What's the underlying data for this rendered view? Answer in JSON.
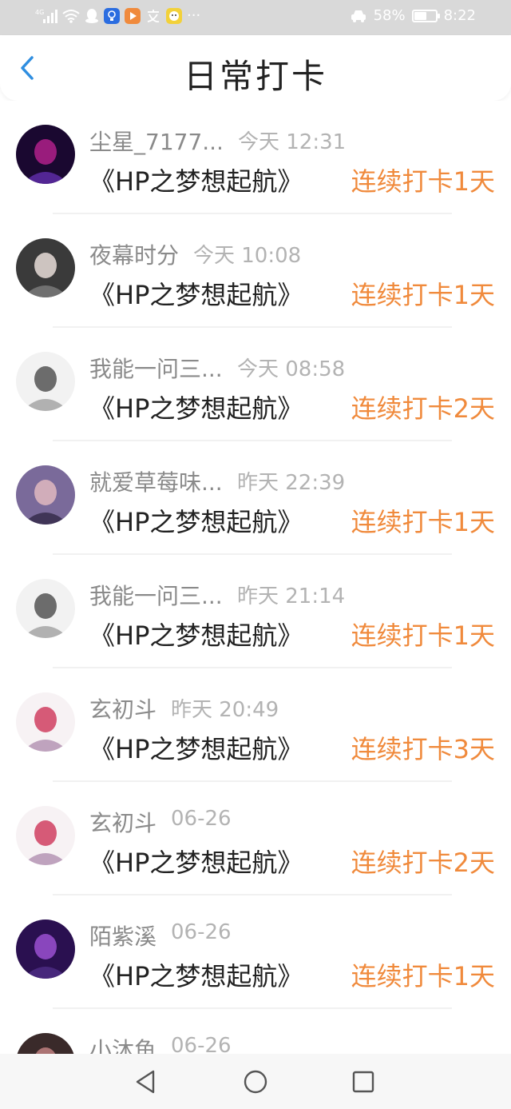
{
  "status_bar": {
    "network": "4G",
    "battery_text": "58%",
    "battery_level": 0.58,
    "time": "8:22",
    "more": "···"
  },
  "header": {
    "title": "日常打卡"
  },
  "checkins": [
    {
      "name": "尘星_7177...",
      "time": "今天 12:31",
      "book": "《HP之梦想起航》",
      "streak": "连续打卡1天"
    },
    {
      "name": "夜幕时分",
      "time": "今天 10:08",
      "book": "《HP之梦想起航》",
      "streak": "连续打卡1天"
    },
    {
      "name": "我能一问三...",
      "time": "今天 08:58",
      "book": "《HP之梦想起航》",
      "streak": "连续打卡2天"
    },
    {
      "name": "就爱草莓味...",
      "time": "昨天 22:39",
      "book": "《HP之梦想起航》",
      "streak": "连续打卡1天"
    },
    {
      "name": "我能一问三...",
      "time": "昨天 21:14",
      "book": "《HP之梦想起航》",
      "streak": "连续打卡1天"
    },
    {
      "name": "玄初斗",
      "time": "昨天 20:49",
      "book": "《HP之梦想起航》",
      "streak": "连续打卡3天"
    },
    {
      "name": "玄初斗",
      "time": "06-26",
      "book": "《HP之梦想起航》",
      "streak": "连续打卡2天"
    },
    {
      "name": "陌紫溪",
      "time": "06-26",
      "book": "《HP之梦想起航》",
      "streak": "连续打卡1天"
    },
    {
      "name": "小沐鱼",
      "time": "06-26",
      "book": "",
      "streak": ""
    }
  ],
  "colors": {
    "accent_back": "#2f8ee0",
    "streak": "#f08a3c",
    "status_bar_bg": "#d9d9d9"
  },
  "icons": [
    "back-arrow-icon",
    "nav-back-icon",
    "nav-home-icon",
    "nav-recents-icon"
  ]
}
